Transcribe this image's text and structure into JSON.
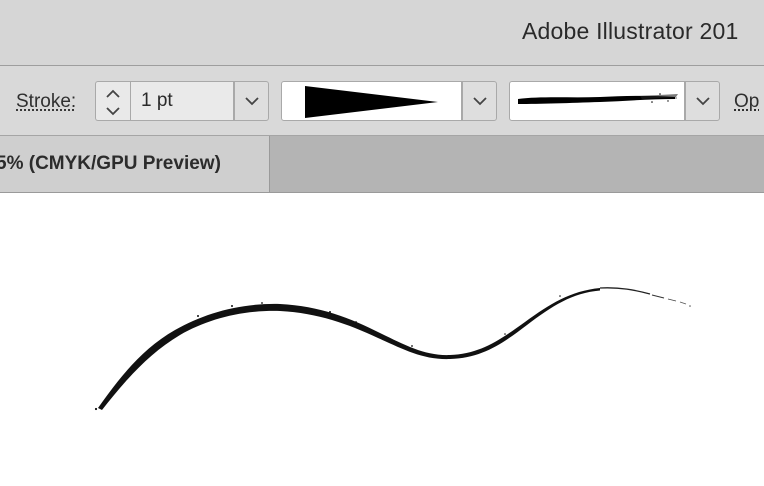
{
  "titlebar": {
    "app_title": "Adobe Illustrator 201"
  },
  "controlbar": {
    "stroke_label": "Stroke:",
    "stroke_weight": "1 pt",
    "variable_width_profile": "Width Profile (tapered)",
    "brush_definition": "Charcoal brush",
    "opacity_label_partial": "Op"
  },
  "document_tab": {
    "label": "5% (CMYK/GPU Preview)"
  },
  "artwork": {
    "description": "S-curve path painted with charcoal brush stroke",
    "stroke_color": "#111111"
  },
  "colors": {
    "chrome_light": "#d9d9d9",
    "tab_bar": "#b4b4b4",
    "active_tab": "#cfcfcf",
    "canvas": "#ffffff"
  }
}
